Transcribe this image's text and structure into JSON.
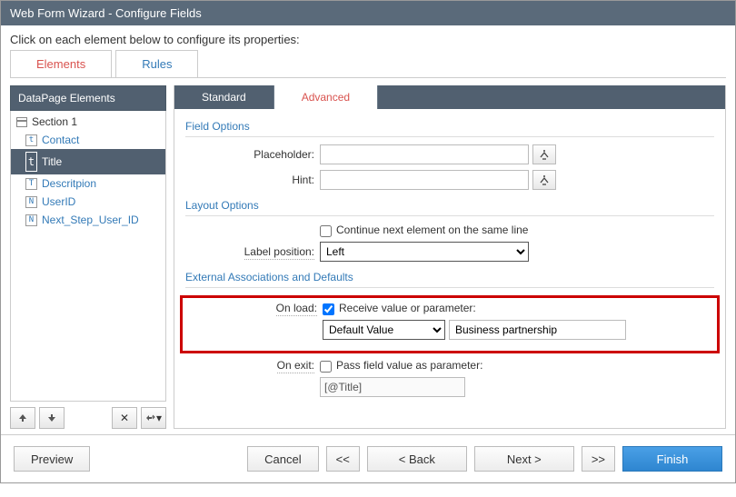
{
  "titlebar": "Web Form Wizard - Configure Fields",
  "instructions": "Click on each element below to configure its properties:",
  "top_tabs": {
    "elements": "Elements",
    "rules": "Rules"
  },
  "left": {
    "header": "DataPage Elements",
    "section": {
      "label": "Section 1"
    },
    "items": [
      {
        "label": "Contact"
      },
      {
        "label": "Title"
      },
      {
        "label": "Descritpion"
      },
      {
        "label": "UserID"
      },
      {
        "label": "Next_Step_User_ID"
      }
    ]
  },
  "sub_tabs": {
    "standard": "Standard",
    "advanced": "Advanced"
  },
  "sections": {
    "field_options": "Field Options",
    "layout_options": "Layout Options",
    "external": "External Associations and Defaults"
  },
  "labels": {
    "placeholder": "Placeholder:",
    "hint": "Hint:",
    "continue_line": "Continue next element on the same line",
    "label_position": "Label position:",
    "on_load": "On load:",
    "receive_value": "Receive value or parameter:",
    "on_exit": "On exit:",
    "pass_value": "Pass field value as parameter:"
  },
  "values": {
    "placeholder": "",
    "hint": "",
    "label_position": "Left",
    "default_mode": "Default Value",
    "default_value": "Business partnership",
    "exit_param": "[@Title]"
  },
  "footer": {
    "preview": "Preview",
    "cancel": "Cancel",
    "prev_fast": "<<",
    "back": "< Back",
    "next": "Next >",
    "next_fast": ">>",
    "finish": "Finish"
  }
}
